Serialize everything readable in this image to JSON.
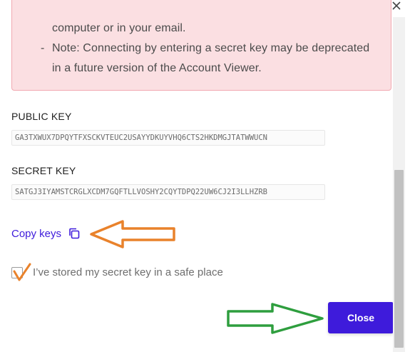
{
  "warning": {
    "line1": "computer or in your email.",
    "bullet": "-",
    "line2": "Note: Connecting by entering a secret key may be deprecated",
    "line3": "in a future version of the Account Viewer."
  },
  "public_key": {
    "label": "PUBLIC KEY",
    "value": "GA3TXWUX7DPQYTFXSCKVTEUC2USAYYDKUYVHQ6CTS2HKDMGJTATWWUCN"
  },
  "secret_key": {
    "label": "SECRET KEY",
    "value": "SATGJ3IYAMSTCRGLXCDM7GQFTLLVOSHY2CQYTDPQ22UW6CJ2I3LLHZRB"
  },
  "copy": {
    "label": "Copy keys",
    "icon": "copy-icon"
  },
  "confirm": {
    "label": "I’ve stored my secret key in a safe place",
    "checked": false
  },
  "close_button": {
    "label": "Close"
  },
  "colors": {
    "accent": "#3e1bdb",
    "warning_bg": "#fbdfe2",
    "warning_border": "#f1a9b1",
    "annotation_orange": "#e9822b",
    "annotation_green": "#2e9e3e"
  }
}
